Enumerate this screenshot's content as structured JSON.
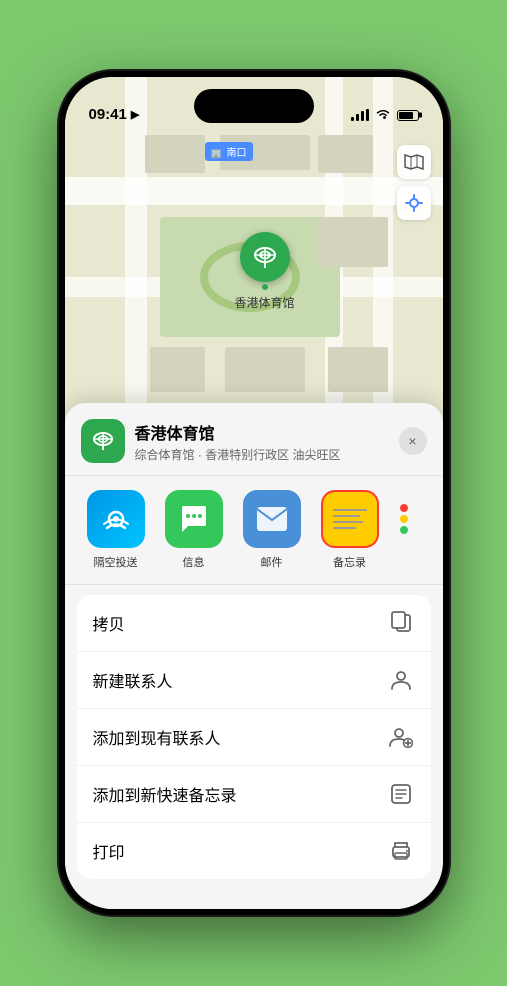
{
  "statusBar": {
    "time": "09:41",
    "locationIcon": "▶"
  },
  "mapLabel": {
    "text": "南口"
  },
  "mapControls": {
    "mapTypeIcon": "🗺",
    "locationIcon": "➤"
  },
  "pin": {
    "label": "香港体育馆"
  },
  "sheet": {
    "venueName": "香港体育馆",
    "venueSubtitle": "综合体育馆 · 香港特别行政区 油尖旺区",
    "closeLabel": "×"
  },
  "shareItems": [
    {
      "id": "airdrop",
      "label": "隔空投送"
    },
    {
      "id": "message",
      "label": "信息"
    },
    {
      "id": "mail",
      "label": "邮件"
    },
    {
      "id": "notes",
      "label": "备忘录"
    }
  ],
  "moreDots": {
    "colors": [
      "#ff3b30",
      "#ffcc00",
      "#34c759"
    ]
  },
  "actionItems": [
    {
      "label": "拷贝",
      "icon": "copy"
    },
    {
      "label": "新建联系人",
      "icon": "person"
    },
    {
      "label": "添加到现有联系人",
      "icon": "person-add"
    },
    {
      "label": "添加到新快速备忘录",
      "icon": "note"
    },
    {
      "label": "打印",
      "icon": "print"
    }
  ]
}
